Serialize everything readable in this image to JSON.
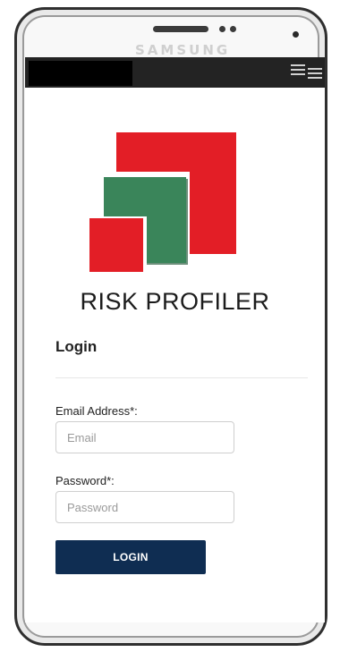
{
  "device": {
    "brand": "SAMSUNG"
  },
  "app": {
    "title": "RISK PROFILER"
  },
  "login": {
    "heading": "Login",
    "email": {
      "label": "Email Address*:",
      "placeholder": "Email",
      "value": ""
    },
    "password": {
      "label": "Password*:",
      "placeholder": "Password",
      "value": ""
    },
    "submit_label": "LOGIN"
  },
  "icons": {
    "menu": "hamburger-menu-icon",
    "logo": "risk-profiler-logo"
  },
  "colors": {
    "logo_red": "#e31e26",
    "logo_green": "#3a855a",
    "button_navy": "#0f2d52",
    "top_bar": "#232323"
  }
}
